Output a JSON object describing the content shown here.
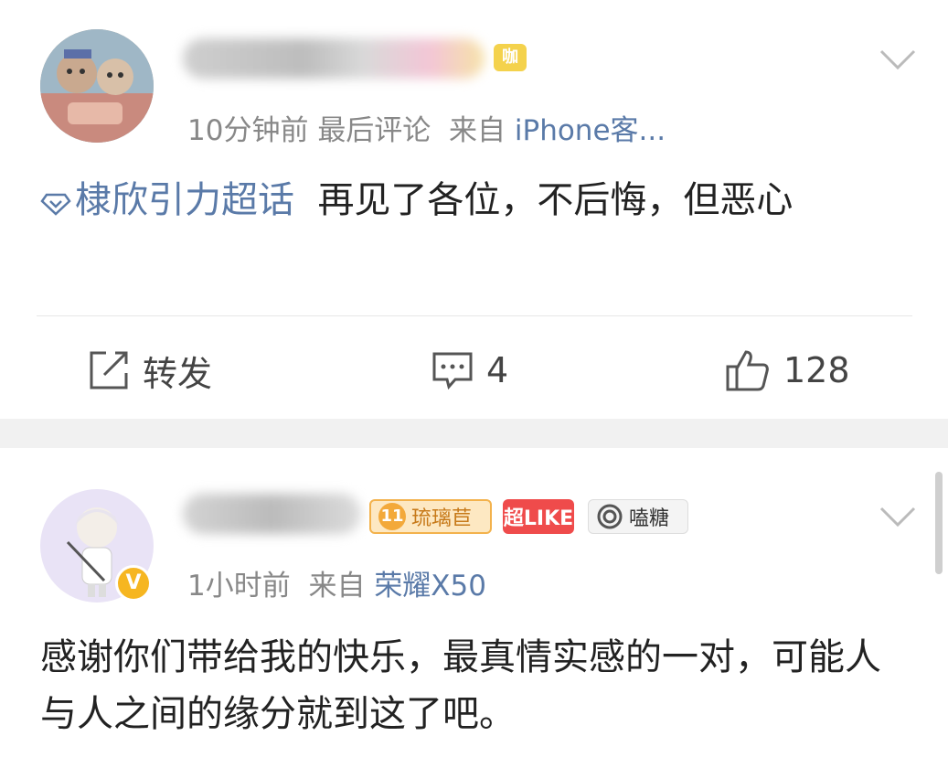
{
  "post1": {
    "username": "",
    "vip_label": "咖",
    "time": "10分钟前",
    "last_comment": "最后评论",
    "from_label": "来自",
    "source": "iPhone客...",
    "topic": "棣欣引力超话",
    "text": "再见了各位，不后悔，但恶心",
    "actions": {
      "repost": "转发",
      "comments": "4",
      "likes": "128"
    }
  },
  "post2": {
    "username": "",
    "badges": {
      "liuli_level": "11",
      "liuli": "琉璃苣",
      "like": "超LIKE",
      "tang": "嗑糖"
    },
    "verified": "V",
    "time": "1小时前",
    "from_label": "来自",
    "source": "荣耀X50",
    "text": "感谢你们带给我的快乐，最真情实感的一对，可能人与人之间的缘分就到这了吧。"
  },
  "icons": {
    "repost": "share-edit-icon",
    "comment": "comment-icon",
    "like": "thumbs-up-icon",
    "menu": "chevron-down-icon",
    "topic": "diamond-icon"
  },
  "colors": {
    "link": "#5a7aa8",
    "meta": "#888888",
    "separator": "#f1f1f1"
  }
}
